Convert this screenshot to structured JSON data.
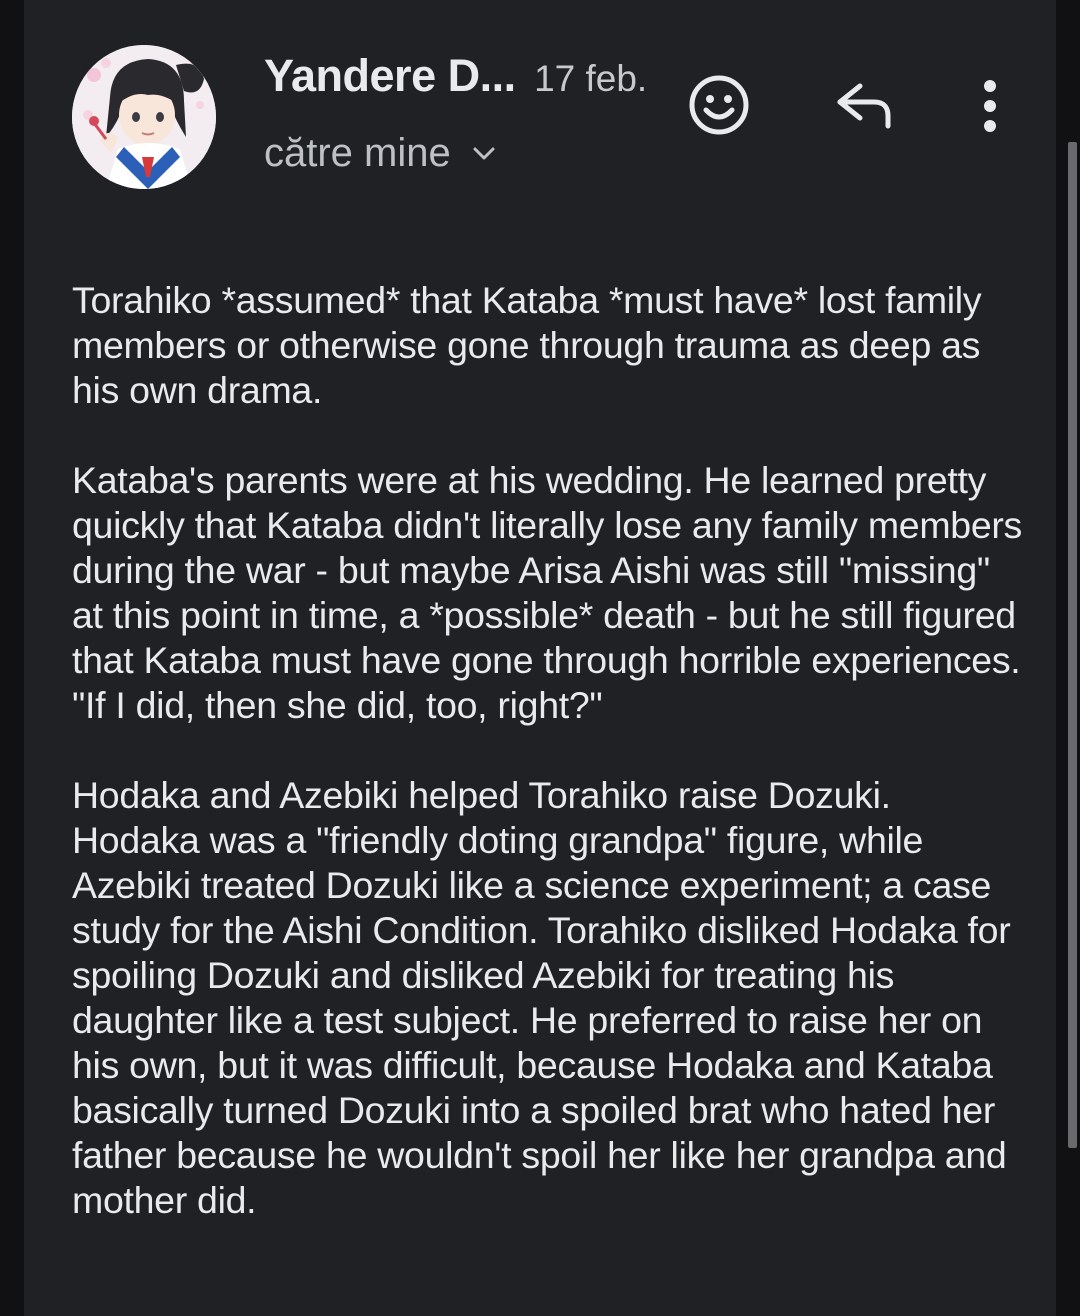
{
  "header": {
    "sender_name": "Yandere D...",
    "date": "17 feb.",
    "recipient_label": "către mine",
    "avatar_icon": "anime-girl-avatar",
    "actions": {
      "emoji_icon": "smiley-face-icon",
      "reply_icon": "reply-arrow-icon",
      "more_icon": "vertical-dots-icon"
    }
  },
  "message": {
    "paragraphs": [
      "Torahiko *assumed* that Kataba *must have* lost family members or otherwise gone through trauma as deep as his own drama.",
      "Kataba's parents were at his wedding. He learned pretty quickly that Kataba didn't literally lose any family members during the war - but maybe Arisa Aishi was still \"missing\" at this point in time, a *possible* death - but he still figured that Kataba must have gone through horrible experiences. \"If I did, then she did, too, right?\"",
      "Hodaka and Azebiki helped Torahiko raise Dozuki. Hodaka was a \"friendly doting grandpa\" figure, while Azebiki treated Dozuki like a science experiment; a case study for the Aishi Condition. Torahiko disliked Hodaka for spoiling Dozuki and disliked Azebiki for treating his daughter like a test subject. He preferred to raise her on his own, but it was difficult, because Hodaka and Kataba basically turned Dozuki into a spoiled brat who hated her father because he wouldn't spoil her like her grandpa and mother did."
    ]
  },
  "colors": {
    "background": "#202124",
    "outer_background": "#111113",
    "text_primary": "#e8eaed",
    "text_secondary": "#bdc1c6"
  }
}
